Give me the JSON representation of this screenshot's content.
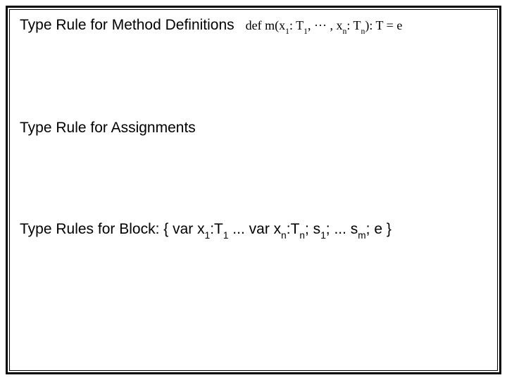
{
  "headings": {
    "method_defs": "Type Rule for Method Definitions",
    "assignments": "Type Rule for Assignments",
    "block": "Type Rules for Block: { var x",
    "block_mid1": ":T",
    "block_mid2": " ... var x",
    "block_mid3": ":T",
    "block_mid4": "; s",
    "block_mid5": "; ... s",
    "block_mid6": "; e }"
  },
  "subs": {
    "one_a": "1",
    "one_b": "1",
    "n_a": "n",
    "n_b": "n",
    "one_c": "1",
    "m": "m"
  },
  "formula": {
    "def": "def",
    "m_open": " m(x",
    "colon_t1": ": T",
    "comma_dots": ", ··· , x",
    "colon_tn": ": T",
    "close_colon_t": "): T = e"
  },
  "formula_subs": {
    "one_a": "1",
    "one_b": "1",
    "n_a": "n",
    "n_b": "n"
  }
}
